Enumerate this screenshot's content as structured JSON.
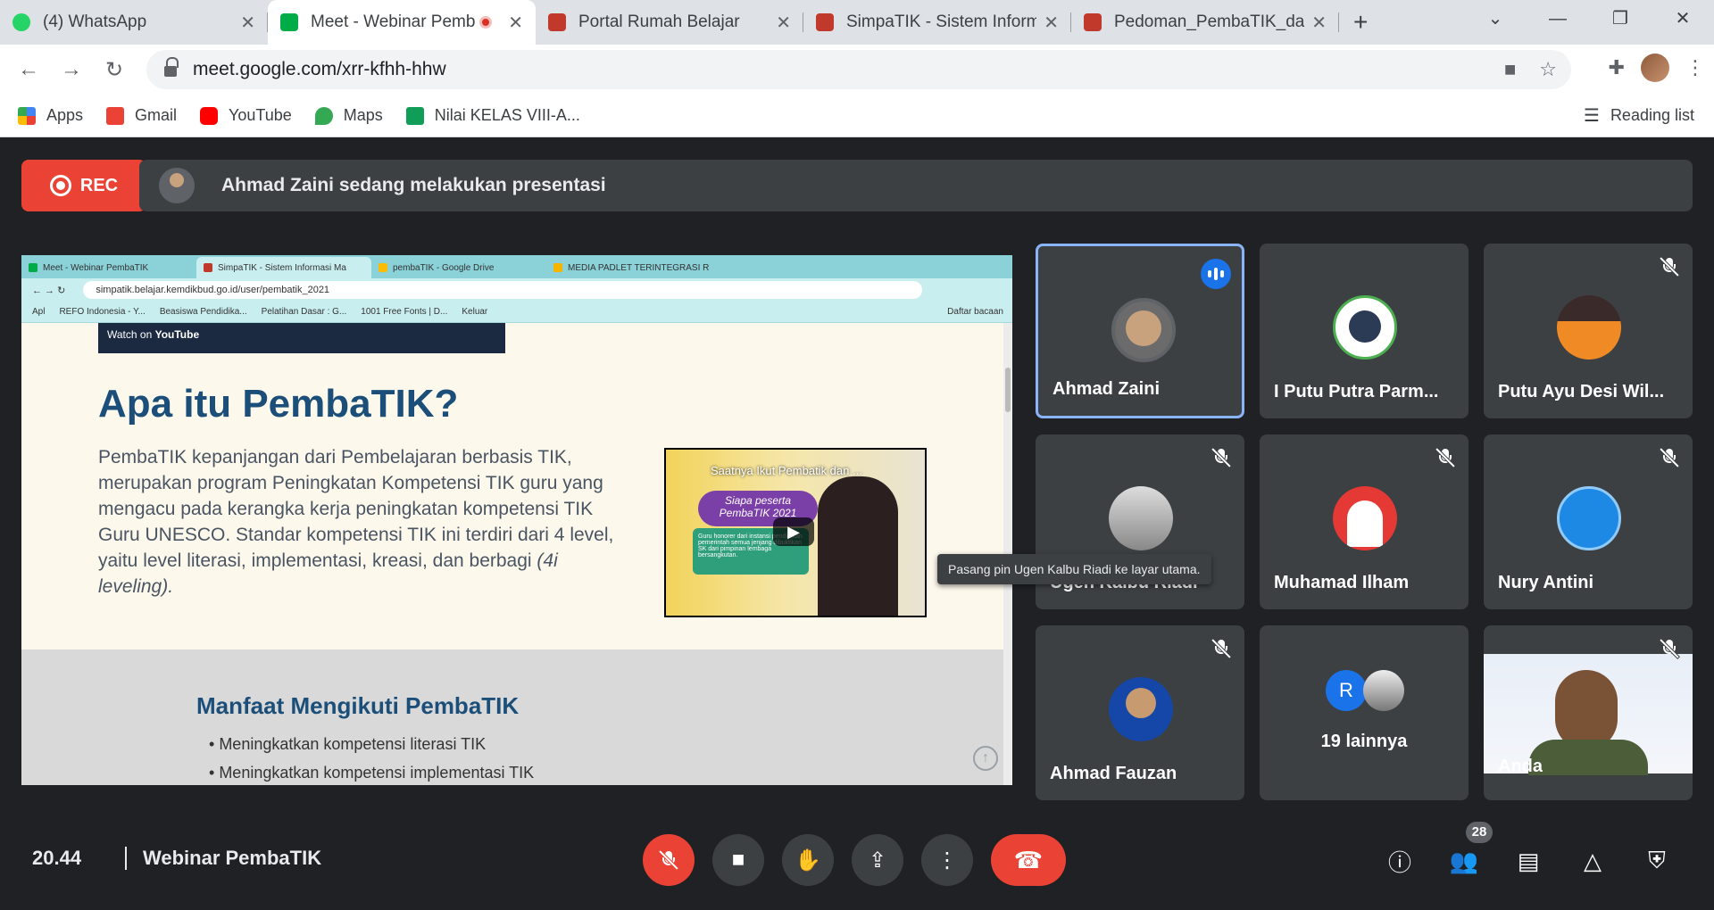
{
  "browser": {
    "tabs": [
      {
        "title": "(4) WhatsApp",
        "color": "#25d366"
      },
      {
        "title": "Meet - Webinar Pemb",
        "color": "#00ac47"
      },
      {
        "title": "Portal Rumah Belajar",
        "color": "#c0392b"
      },
      {
        "title": "SimpaTIK - Sistem Inform",
        "color": "#c0392b"
      },
      {
        "title": "Pedoman_PembaTIK_dan",
        "color": "#c0392b"
      }
    ],
    "url": "meet.google.com/xrr-kfhh-hhw",
    "bookmarks": [
      {
        "label": "Apps",
        "color": "#4285f4"
      },
      {
        "label": "Gmail",
        "color": "#ea4335"
      },
      {
        "label": "YouTube",
        "color": "#ff0000"
      },
      {
        "label": "Maps",
        "color": "#34a853"
      },
      {
        "label": "Nilai KELAS VIII-A...",
        "color": "#0f9d58"
      }
    ],
    "reading_list": "Reading list"
  },
  "meet": {
    "rec_label": "REC",
    "presenting_text": "Ahmad Zaini sedang melakukan presentasi",
    "time": "20.44",
    "meeting_name": "Webinar PembaTIK",
    "participant_count": "28",
    "tooltip": "Pasang pin Ugen Kalbu Riadi ke layar utama.",
    "participants": [
      {
        "name": "Ahmad Zaini",
        "muted": false,
        "speaking": true
      },
      {
        "name": "I Putu Putra Parm...",
        "muted": false
      },
      {
        "name": "Putu Ayu Desi Wil...",
        "muted": true
      },
      {
        "name": "Ugen Kalbu Riadi",
        "muted": true
      },
      {
        "name": "Muhamad Ilham",
        "muted": true
      },
      {
        "name": "Nury Antini",
        "muted": true
      },
      {
        "name": "Ahmad Fauzan",
        "muted": true
      },
      {
        "name": "19 lainnya",
        "initial": "R"
      },
      {
        "name": "Anda",
        "muted": true
      }
    ]
  },
  "shared": {
    "tabs": [
      "Meet - Webinar PembaTIK",
      "SimpaTIK - Sistem Informasi Ma",
      "pembaTIK - Google Drive",
      "MEDIA PADLET TERINTEGRASI R"
    ],
    "url": "simpatik.belajar.kemdikbud.go.id/user/pembatik_2021",
    "bookmarks": [
      "Apl",
      "REFO Indonesia - Y...",
      "Beasiswa Pendidika...",
      "Pelatihan Dasar : G...",
      "1001 Free Fonts | D...",
      "Keluar"
    ],
    "bookmark_right": "Daftar bacaan",
    "watch_on": "Watch on",
    "youtube": "YouTube",
    "heading": "Apa itu PembaTIK?",
    "paragraph": "PembaTIK kepanjangan dari Pembelajaran berbasis TIK, merupakan program Peningkatan Kompetensi TIK guru yang mengacu pada kerangka kerja peningkatan kompetensi TIK Guru UNESCO. Standar kompetensi TIK ini terdiri dari 4 level, yaitu level literasi, implementasi, kreasi, dan berbagi",
    "paragraph_italic": "(4i leveling).",
    "video_title": "Saatnya Ikut Pembatik dan ...",
    "video_bubble": "Siapa peserta PembaTIK 2021",
    "video_card": "Guru honorer dari instansi pendidikan pemerintah semua jenjang dibuktikan SK dari pimpinan lembaga bersangkutan.",
    "subheading": "Manfaat Mengikuti PembaTIK",
    "list": [
      "Meningkatkan kompetensi literasi TIK",
      "Meningkatkan kompetensi implementasi TIK"
    ]
  }
}
